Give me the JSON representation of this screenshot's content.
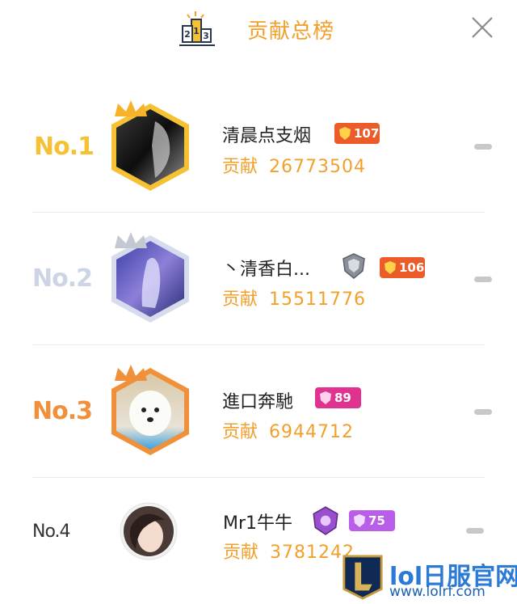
{
  "header": {
    "title": "贡献总榜"
  },
  "contrib_label": "贡献",
  "rows": [
    {
      "rank": "No.1",
      "name": "清晨点支烟",
      "level": "107",
      "contribution": "26773504"
    },
    {
      "rank": "No.2",
      "name": "丶清香白...",
      "level": "106",
      "contribution": "15511776"
    },
    {
      "rank": "No.3",
      "name": "進口奔馳",
      "level": "89",
      "contribution": "6944712"
    },
    {
      "rank": "No.4",
      "name": "Mr1牛牛",
      "level": "75",
      "contribution": "3781242"
    }
  ],
  "watermark": {
    "title": "lol日服官网",
    "url": "www.lolrf.com"
  },
  "colors": {
    "accent": "#f2a02b",
    "gold": "#f6c234",
    "silver": "#ccd4e6",
    "bronze": "#f0903a"
  }
}
